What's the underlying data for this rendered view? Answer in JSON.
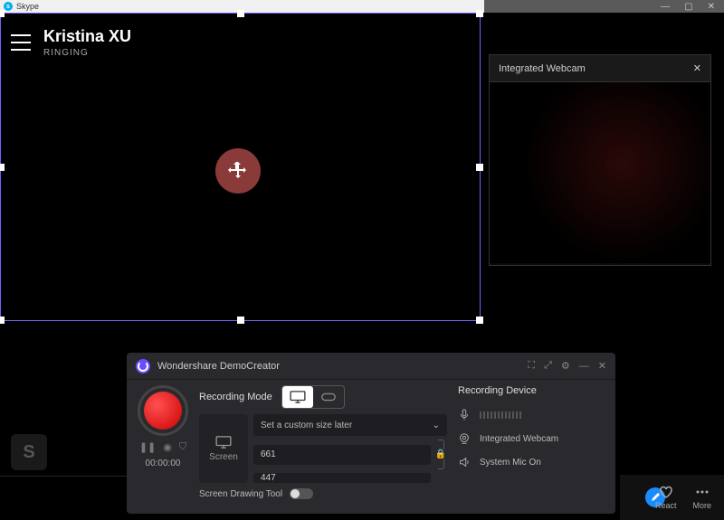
{
  "skype": {
    "app_name": "Skype",
    "caller": "Kristina XU",
    "status": "RINGING"
  },
  "webcam": {
    "title": "Integrated Webcam"
  },
  "demo": {
    "title": "Wondershare DemoCreator",
    "timer": "00:00:00",
    "mode_label": "Recording Mode",
    "screen_tab": "Screen",
    "size_preset": "Set a custom size later",
    "width": "661",
    "height": "447",
    "draw_label": "Screen Drawing Tool",
    "device_title": "Recording Device",
    "webcam_device": "Integrated Webcam",
    "mic_device": "System Mic On"
  },
  "bottom": {
    "react": "React",
    "more": "More"
  }
}
